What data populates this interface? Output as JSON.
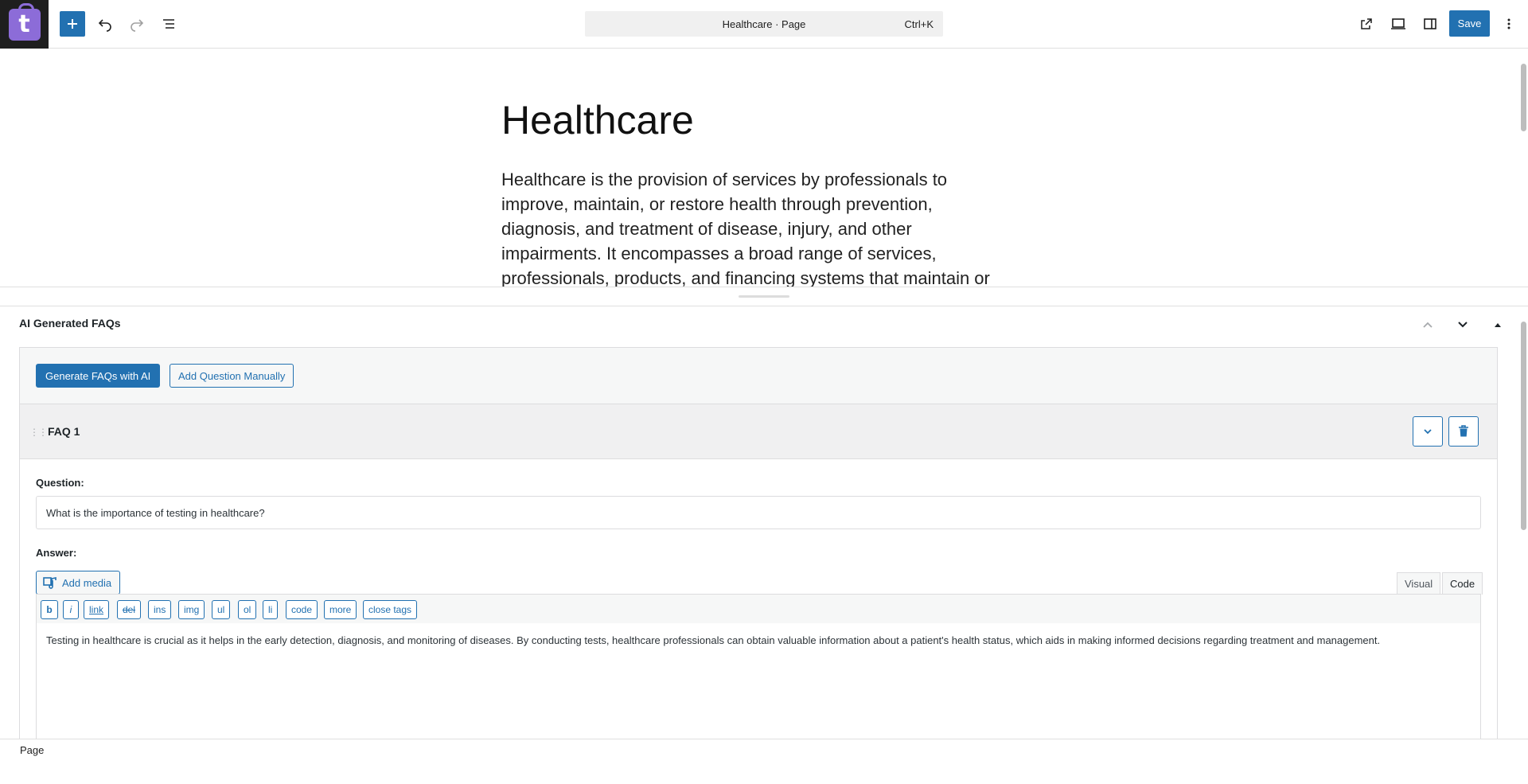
{
  "topbar": {
    "logo_letter": "t",
    "document_title": "Healthcare · Page",
    "shortcut": "Ctrl+K",
    "save_label": "Save",
    "icons": [
      "add-icon",
      "undo-icon",
      "redo-icon",
      "list-view-icon",
      "external-link-icon",
      "desktop-preview-icon",
      "sidebar-icon",
      "more-vertical-icon"
    ]
  },
  "post": {
    "title": "Healthcare",
    "body": "Healthcare is the provision of services by professionals to improve, maintain, or restore health through prevention, diagnosis, and treatment of disease, injury, and other impairments. It encompasses a broad range of services, professionals, products, and financing systems that maintain or"
  },
  "metabox": {
    "title": "AI Generated FAQs",
    "generate_label": "Generate FAQs with AI",
    "add_manual_label": "Add Question Manually",
    "faq": {
      "label": "FAQ 1",
      "question_label": "Question:",
      "question_value": "What is the importance of testing in healthcare?",
      "answer_label": "Answer:",
      "add_media_label": "Add media",
      "tabs": [
        "Visual",
        "Code"
      ],
      "active_tab": "Code",
      "quicktags": [
        "b",
        "i",
        "link",
        "del",
        "ins",
        "img",
        "ul",
        "ol",
        "li",
        "code",
        "more",
        "close tags"
      ],
      "answer_text": "Testing in healthcare is crucial as it helps in the early detection, diagnosis, and monitoring of diseases. By conducting tests, healthcare professionals can obtain valuable information about a patient's health status, which aids in making informed decisions regarding treatment and management."
    }
  },
  "footer": {
    "breadcrumb": "Page"
  },
  "colors": {
    "accent": "#2271b1",
    "logo": "#8c6cd8",
    "dark": "#1e1e1e"
  }
}
